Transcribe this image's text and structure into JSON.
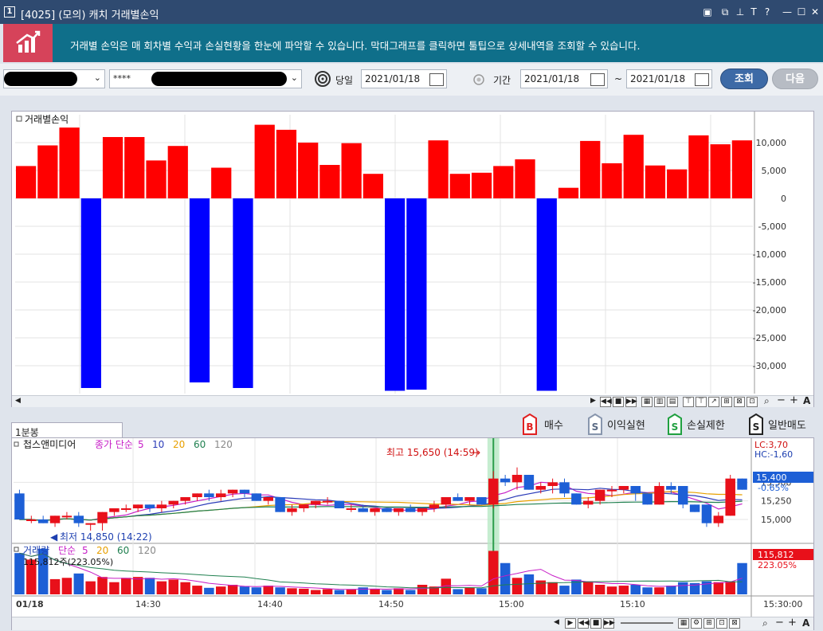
{
  "window": {
    "number": "1",
    "title": "[4025] (모의) 캐치 거래별손익"
  },
  "banner": {
    "message": "거래별 손익은 매 회차별 수익과 손실현황을 한눈에 파악할 수 있습니다. 막대그래프를 클릭하면 툴팁으로 상세내역을 조회할 수 있습니다."
  },
  "toolbar": {
    "password": "****",
    "today_label": "당일",
    "today_date": "2021/01/18",
    "period_label": "기간",
    "period_from": "2021/01/18",
    "tilde": "~",
    "period_to": "2021/01/18",
    "search_button": "조회",
    "next_button": "다음"
  },
  "tab": {
    "label": "1분봉"
  },
  "legend": {
    "buy": "매수",
    "profit": "이익실현",
    "stop": "손실제한",
    "sell": "일반매도"
  },
  "colors": {
    "profit": "#ff0000",
    "loss": "#0000ff",
    "accent": "#2f4a70"
  },
  "chart_data": [
    {
      "type": "bar",
      "title": "거래별손익",
      "ylim": [
        -35000,
        15000
      ],
      "yticks": [
        "10,000",
        "5,000",
        "0",
        "-5,000",
        "-10,000",
        "-15,000",
        "-20,000",
        "-25,000",
        "-30,000"
      ],
      "values": [
        5800,
        9500,
        12700,
        -34000,
        11000,
        11000,
        6800,
        9400,
        -33000,
        5500,
        -34000,
        13200,
        12300,
        10000,
        6000,
        9900,
        4400,
        -34500,
        -34300,
        10400,
        4400,
        4600,
        5800,
        7000,
        -34500,
        1900,
        10300,
        6300,
        11400,
        5900,
        5200,
        11300,
        9700,
        10400
      ]
    },
    {
      "type": "candlestick",
      "title": "첩스앤미디어",
      "indicator_label": "종가 단순",
      "ma_periods": [
        "5",
        "10",
        "20",
        "60",
        "120"
      ],
      "ylim": [
        14700,
        15900
      ],
      "yticks": [
        "15,500",
        "15,250",
        "15,000"
      ],
      "xticks": [
        "01/18",
        "14:30",
        "14:40",
        "14:50",
        "15:00",
        "15:10",
        "15:30:00"
      ],
      "annotations": {
        "high": "최고 15,650 (14:59)",
        "low": "최저 14,850 (14:22)"
      },
      "right_info": {
        "lc": "LC:3,70",
        "hc": "HC:-1,60",
        "price": "15,400",
        "change": "-0.65%"
      },
      "candles": [
        [
          15350,
          15400,
          15000,
          15000
        ],
        [
          15000,
          15050,
          14950,
          15000
        ],
        [
          15000,
          15050,
          14950,
          14950
        ],
        [
          14950,
          15050,
          14900,
          15050
        ],
        [
          15050,
          15100,
          15000,
          15050
        ],
        [
          15050,
          15100,
          14900,
          14950
        ],
        [
          14950,
          14950,
          14850,
          14950
        ],
        [
          14950,
          15100,
          14850,
          15100
        ],
        [
          15100,
          15150,
          15050,
          15150
        ],
        [
          15150,
          15200,
          15100,
          15150
        ],
        [
          15150,
          15200,
          15100,
          15200
        ],
        [
          15200,
          15200,
          15100,
          15150
        ],
        [
          15150,
          15250,
          15100,
          15200
        ],
        [
          15200,
          15250,
          15150,
          15250
        ],
        [
          15250,
          15300,
          15200,
          15300
        ],
        [
          15300,
          15350,
          15250,
          15350
        ],
        [
          15350,
          15400,
          15250,
          15300
        ],
        [
          15300,
          15400,
          15250,
          15350
        ],
        [
          15350,
          15400,
          15300,
          15400
        ],
        [
          15400,
          15400,
          15300,
          15350
        ],
        [
          15350,
          15350,
          15250,
          15250
        ],
        [
          15250,
          15300,
          15200,
          15300
        ],
        [
          15300,
          15300,
          15100,
          15100
        ],
        [
          15100,
          15200,
          15050,
          15150
        ],
        [
          15150,
          15200,
          15100,
          15200
        ],
        [
          15200,
          15250,
          15150,
          15250
        ],
        [
          15250,
          15300,
          15200,
          15250
        ],
        [
          15250,
          15250,
          15150,
          15150
        ],
        [
          15150,
          15200,
          15100,
          15150
        ],
        [
          15150,
          15200,
          15100,
          15100
        ],
        [
          15100,
          15150,
          15050,
          15150
        ],
        [
          15150,
          15150,
          15100,
          15100
        ],
        [
          15100,
          15150,
          15050,
          15150
        ],
        [
          15150,
          15200,
          15100,
          15100
        ],
        [
          15100,
          15150,
          15050,
          15150
        ],
        [
          15150,
          15250,
          15100,
          15200
        ],
        [
          15200,
          15300,
          15150,
          15300
        ],
        [
          15300,
          15350,
          15250,
          15250
        ],
        [
          15250,
          15300,
          15200,
          15300
        ],
        [
          15300,
          15300,
          15200,
          15200
        ],
        [
          15200,
          15650,
          15150,
          15550
        ],
        [
          15550,
          15600,
          15450,
          15500
        ],
        [
          15500,
          15700,
          15400,
          15600
        ],
        [
          15600,
          15600,
          15400,
          15400
        ],
        [
          15400,
          15500,
          15350,
          15450
        ],
        [
          15450,
          15550,
          15350,
          15500
        ],
        [
          15500,
          15550,
          15300,
          15350
        ],
        [
          15350,
          15350,
          15200,
          15200
        ],
        [
          15200,
          15300,
          15150,
          15250
        ],
        [
          15250,
          15400,
          15200,
          15400
        ],
        [
          15400,
          15450,
          15300,
          15400
        ],
        [
          15400,
          15450,
          15350,
          15450
        ],
        [
          15450,
          15450,
          15250,
          15350
        ],
        [
          15350,
          15350,
          15200,
          15200
        ],
        [
          15200,
          15500,
          15200,
          15450
        ],
        [
          15450,
          15500,
          15350,
          15400
        ],
        [
          15450,
          15450,
          15150,
          15200
        ],
        [
          15200,
          15200,
          15100,
          15100
        ],
        [
          15200,
          15200,
          14900,
          14950
        ],
        [
          14950,
          15100,
          14900,
          15050
        ],
        [
          15050,
          15600,
          15050,
          15550
        ],
        [
          15550,
          15550,
          15400,
          15400
        ]
      ]
    },
    {
      "type": "bar",
      "title": "거래량",
      "indicator_label": "단순",
      "ma_periods": [
        "5",
        "20",
        "60",
        "120"
      ],
      "value_label": "115,812주(223.05%)",
      "right_info": {
        "volume": "115,812",
        "ratio": "223.05%"
      },
      "values": [
        95,
        80,
        105,
        35,
        38,
        48,
        30,
        40,
        28,
        38,
        40,
        38,
        30,
        34,
        28,
        20,
        15,
        18,
        22,
        18,
        16,
        20,
        16,
        14,
        13,
        10,
        12,
        10,
        12,
        16,
        12,
        10,
        14,
        10,
        22,
        18,
        36,
        12,
        16,
        14,
        100,
        72,
        38,
        46,
        32,
        28,
        20,
        34,
        30,
        22,
        18,
        20,
        22,
        16,
        16,
        20,
        28,
        26,
        30,
        28,
        30,
        72
      ]
    }
  ]
}
